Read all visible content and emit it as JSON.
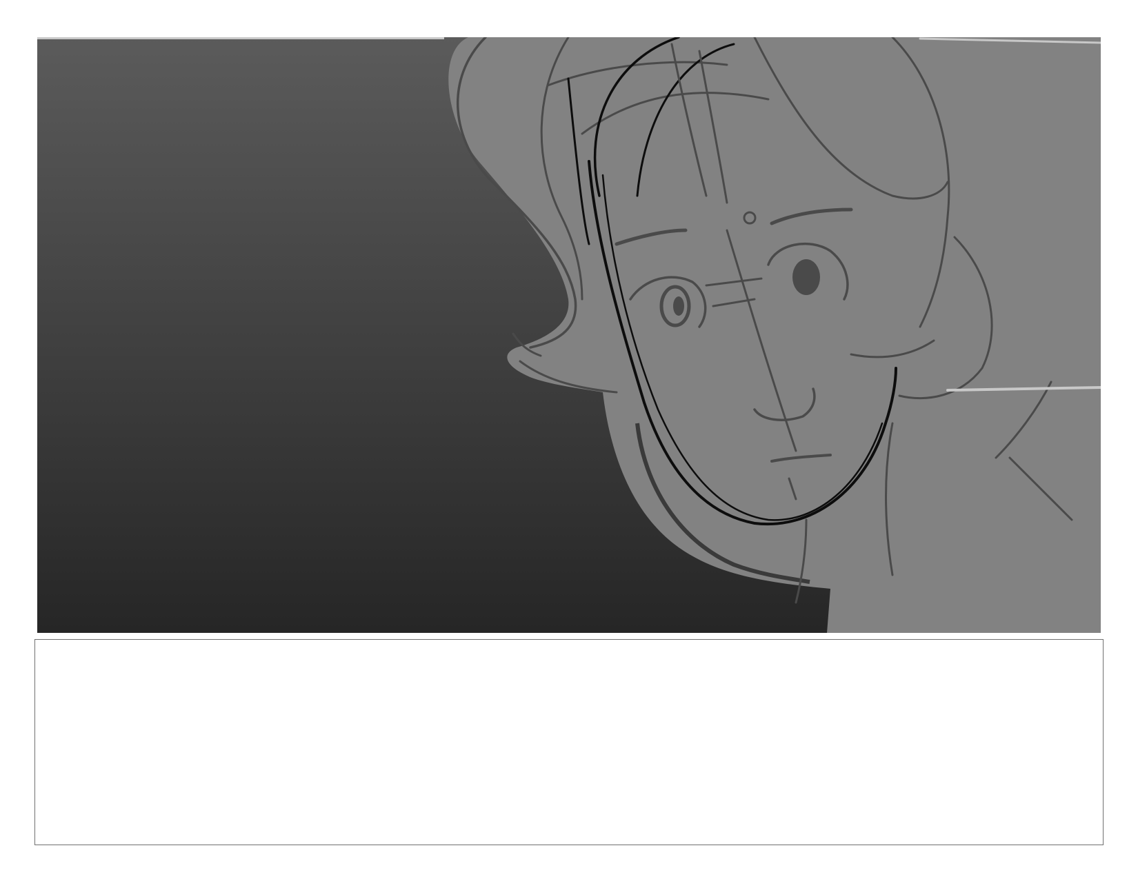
{
  "page": {
    "background": "#ffffff"
  },
  "panel": {
    "background_gradient": [
      "#5b5b5b",
      "#262626"
    ],
    "character_fill": "#828282",
    "line_color_dark": "#4a4a4a",
    "line_color_black": "#0d0d0d",
    "highlight_color": "#c8c8c8"
  },
  "caption": {
    "text": ""
  }
}
